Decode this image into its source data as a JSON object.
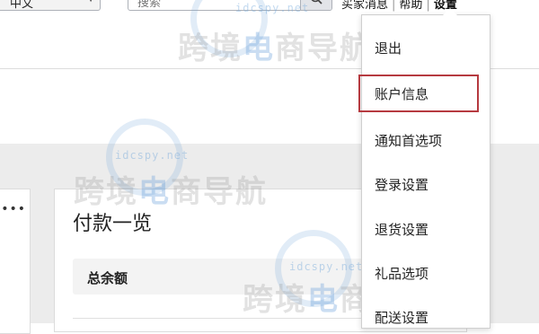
{
  "header": {
    "language_select": {
      "value": "中文"
    },
    "search": {
      "placeholder": "搜索"
    },
    "links": [
      {
        "label": "买家消息"
      },
      {
        "label": "帮助"
      },
      {
        "label": "设置"
      }
    ]
  },
  "dropdown": {
    "items": [
      {
        "label": "退出"
      },
      {
        "label": "账户信息",
        "highlighted": true
      },
      {
        "label": "通知首选项"
      },
      {
        "label": "登录设置"
      },
      {
        "label": "退货设置"
      },
      {
        "label": "礼品选项"
      },
      {
        "label": "配送设置"
      }
    ]
  },
  "main": {
    "left_card": {
      "more_icon": "more-dots-icon"
    },
    "payment_card": {
      "title": "付款一览",
      "balance_label": "总余额"
    }
  },
  "watermark": {
    "text_prefix": "跨境",
    "text_accent": "电",
    "text_suffix": "商导航",
    "url": "idcspy.net"
  },
  "colors": {
    "highlight_border": "#b63a40",
    "watermark_blue": "#78aadc",
    "content_background": "#ececec"
  }
}
